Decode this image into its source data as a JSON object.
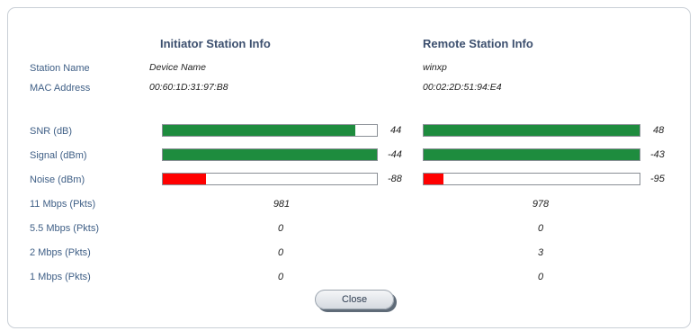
{
  "headers": {
    "initiator": "Initiator Station Info",
    "remote": "Remote Station Info"
  },
  "labels": {
    "station_name": "Station Name",
    "mac_address": "MAC Address",
    "snr": "SNR (dB)",
    "signal": "Signal (dBm)",
    "noise": "Noise (dBm)",
    "r11": "11 Mbps (Pkts)",
    "r55": "5.5 Mbps (Pkts)",
    "r2": "2 Mbps (Pkts)",
    "r1": "1 Mbps (Pkts)"
  },
  "initiator": {
    "station_name": "Device Name",
    "mac": "00:60:1D:31:97:B8",
    "snr": {
      "value": "44",
      "level": 0.9,
      "color": "#1e8c3e"
    },
    "signal": {
      "value": "-44",
      "level": 1.0,
      "color": "#1e8c3e"
    },
    "noise": {
      "value": "-88",
      "level": 0.2,
      "color": "#ff0000"
    },
    "pkts_11": "981",
    "pkts_55": "0",
    "pkts_2": "0",
    "pkts_1": "0"
  },
  "remote": {
    "station_name": "winxp",
    "mac": "00:02:2D:51:94:E4",
    "snr": {
      "value": "48",
      "level": 1.0,
      "color": "#1e8c3e"
    },
    "signal": {
      "value": "-43",
      "level": 1.0,
      "color": "#1e8c3e"
    },
    "noise": {
      "value": "-95",
      "level": 0.09,
      "color": "#ff0000"
    },
    "pkts_11": "978",
    "pkts_55": "0",
    "pkts_2": "3",
    "pkts_1": "0"
  },
  "buttons": {
    "close": "Close"
  }
}
